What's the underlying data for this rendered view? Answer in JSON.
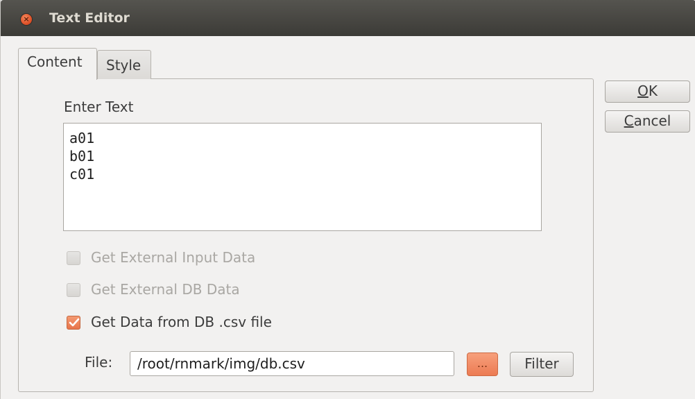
{
  "window": {
    "title": "Text Editor",
    "close_icon": "close-icon"
  },
  "tabs": [
    {
      "label": "Content",
      "active": true
    },
    {
      "label": "Style",
      "active": false
    }
  ],
  "content": {
    "enter_text_label": "Enter Text",
    "text_lines": [
      "a01",
      "b01",
      "c01"
    ],
    "options": [
      {
        "label": "Get External Input Data",
        "checked": false,
        "enabled": false
      },
      {
        "label": "Get External DB Data",
        "checked": false,
        "enabled": false
      },
      {
        "label": "Get Data from DB .csv file",
        "checked": true,
        "enabled": true
      }
    ],
    "file_label": "File:",
    "file_value": "/root/rnmark/img/db.csv",
    "browse_label": "...",
    "filter_label": "Filter"
  },
  "dialog_buttons": {
    "ok_mnemonic": "O",
    "ok_rest": "K",
    "cancel_mnemonic": "C",
    "cancel_rest": "ancel"
  },
  "colors": {
    "accent": "#ec7b53",
    "titlebar": "#3c3b37"
  }
}
